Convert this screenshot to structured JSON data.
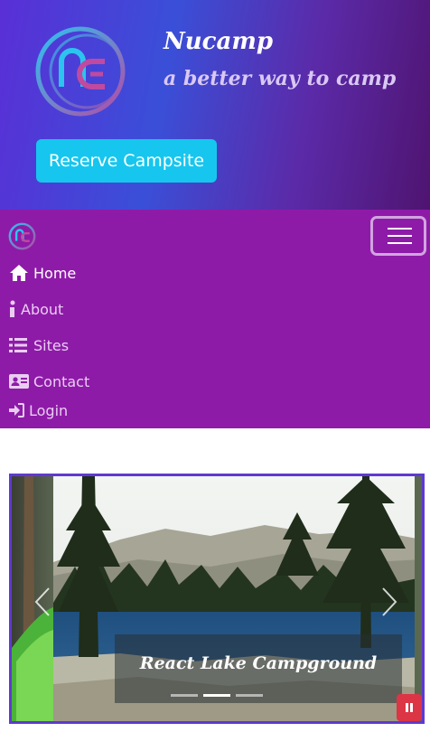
{
  "header": {
    "brand_title": "Nucamp",
    "brand_subtitle": "a better way to camp",
    "reserve_label": "Reserve Campsite",
    "logo_icon": "nucamp-logo-icon",
    "colors": {
      "reserve_button": "#16c6ee"
    }
  },
  "navbar": {
    "toggler_icon": "hamburger-icon",
    "items": [
      {
        "label": "Home",
        "icon": "home-icon",
        "active": true
      },
      {
        "label": "About",
        "icon": "info-icon",
        "active": false
      },
      {
        "label": "Sites",
        "icon": "list-icon",
        "active": false
      },
      {
        "label": "Contact",
        "icon": "address-card-icon",
        "active": false
      },
      {
        "label": "Login",
        "icon": "sign-in-icon",
        "active": false
      }
    ],
    "colors": {
      "background": "#8e1ba8"
    }
  },
  "carousel": {
    "caption": "React Lake Campground",
    "slide_count": 3,
    "active_slide": 2,
    "pause_icon": "pause-icon",
    "colors": {
      "border": "#5d3ad0",
      "pause_button": "#dc3545"
    }
  }
}
